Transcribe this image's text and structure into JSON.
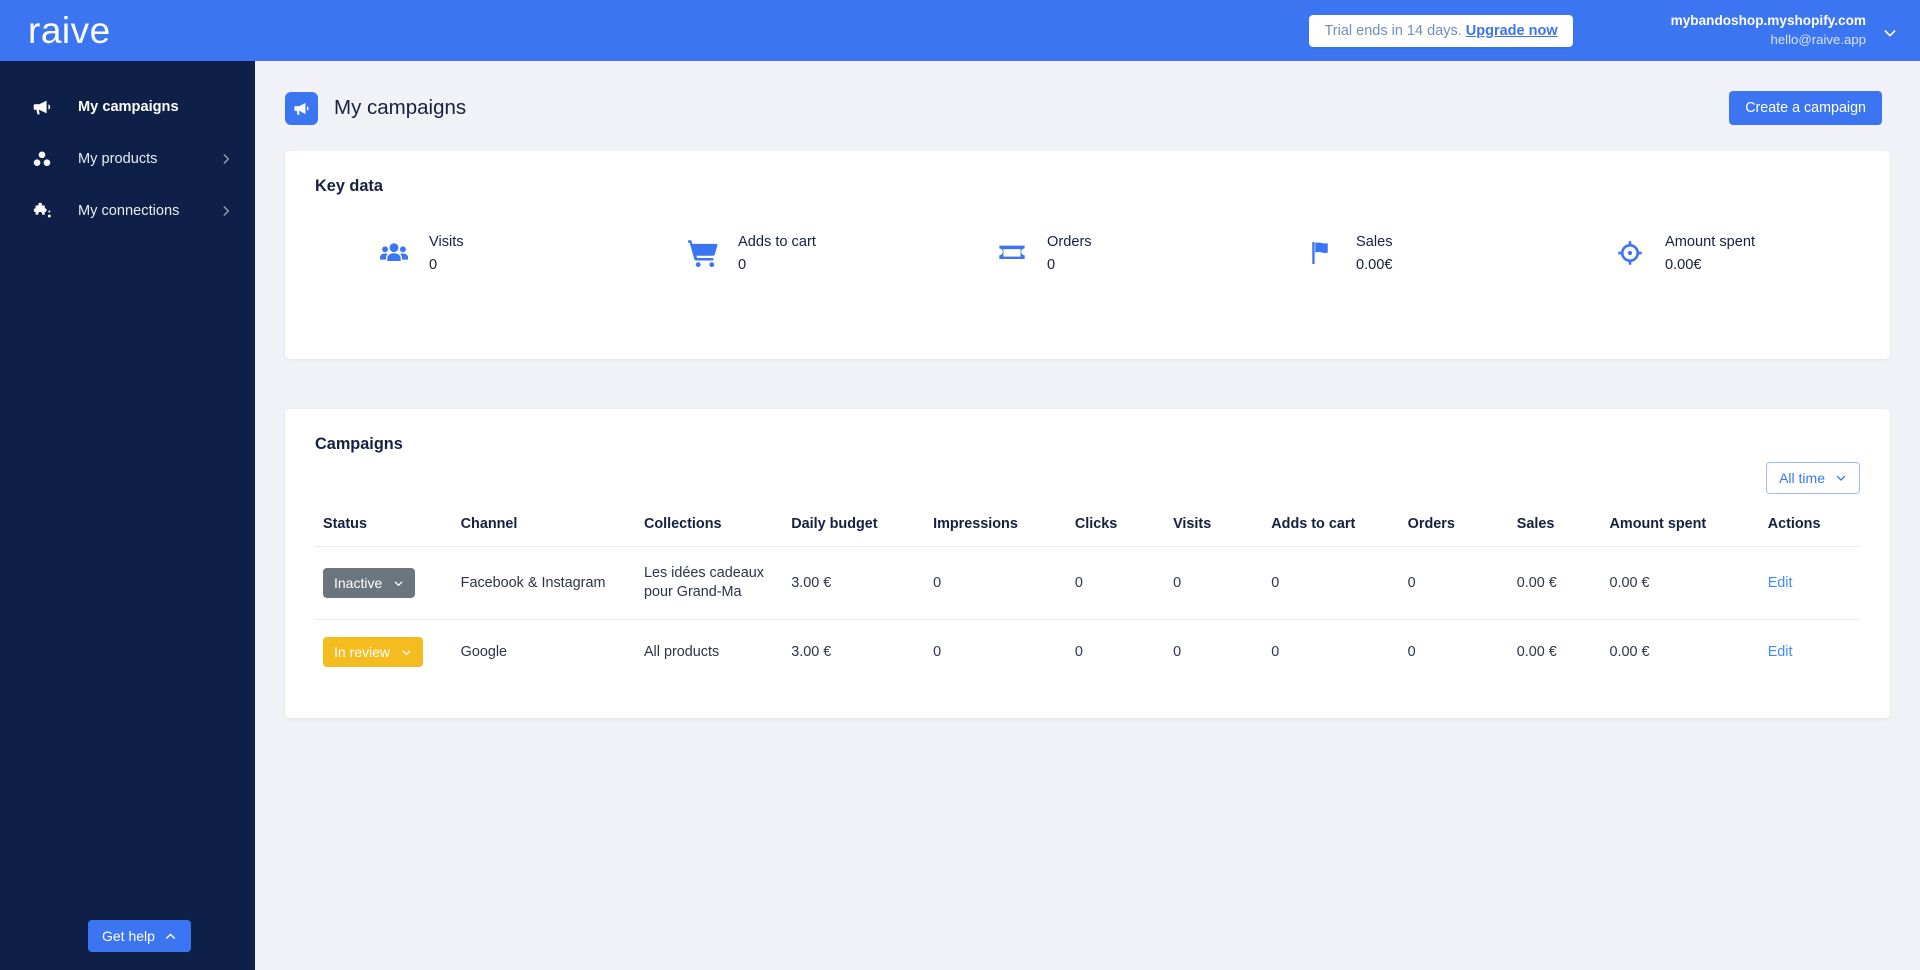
{
  "brand": {
    "name": "raive",
    "accent": "#3b75f2",
    "sidebar_bg": "#0e2047"
  },
  "topbar": {
    "trial_text": "Trial ends in 14 days.",
    "upgrade_label": "Upgrade now",
    "shop": "mybandoshop.myshopify.com",
    "email": "hello@raive.app",
    "account_chevron": "chevron-down-icon"
  },
  "sidebar": {
    "items": [
      {
        "label": "My campaigns",
        "icon": "megaphone-icon",
        "active": true,
        "has_chevron": false
      },
      {
        "label": "My products",
        "icon": "products-cubes-icon",
        "active": false,
        "has_chevron": true
      },
      {
        "label": "My connections",
        "icon": "puzzle-piece-icon",
        "active": false,
        "has_chevron": true
      }
    ],
    "get_help_label": "Get help",
    "get_help_icon": "chevron-up-icon"
  },
  "page": {
    "title": "My campaigns",
    "icon": "megaphone-icon",
    "create_button": "Create a campaign"
  },
  "key_data": {
    "title": "Key data",
    "metrics": [
      {
        "label": "Visits",
        "value": "0",
        "icon": "people-group-icon"
      },
      {
        "label": "Adds to cart",
        "value": "0",
        "icon": "shopping-cart-icon"
      },
      {
        "label": "Orders",
        "value": "0",
        "icon": "ticket-icon"
      },
      {
        "label": "Sales",
        "value": "0.00€",
        "icon": "flag-icon"
      },
      {
        "label": "Amount spent",
        "value": "0.00€",
        "icon": "target-icon"
      }
    ]
  },
  "campaigns": {
    "title": "Campaigns",
    "range_label": "All time",
    "range_icon": "chevron-down-icon",
    "columns": [
      "Status",
      "Channel",
      "Collections",
      "Daily budget",
      "Impressions",
      "Clicks",
      "Visits",
      "Adds to cart",
      "Orders",
      "Sales",
      "Amount spent",
      "Actions"
    ],
    "rows": [
      {
        "status": "Inactive",
        "status_type": "inactive",
        "status_color": "#6b757e",
        "channel": "Facebook & Instagram",
        "collections": "Les idées cadeaux pour Grand-Ma",
        "daily_budget": "3.00 €",
        "impressions": "0",
        "clicks": "0",
        "visits": "0",
        "adds_to_cart": "0",
        "orders": "0",
        "sales": "0.00 €",
        "amount_spent": "0.00 €",
        "action": "Edit"
      },
      {
        "status": "In review",
        "status_type": "review",
        "status_color": "#f5bc20",
        "channel": "Google",
        "collections": "All products",
        "daily_budget": "3.00 €",
        "impressions": "0",
        "clicks": "0",
        "visits": "0",
        "adds_to_cart": "0",
        "orders": "0",
        "sales": "0.00 €",
        "amount_spent": "0.00 €",
        "action": "Edit"
      }
    ]
  }
}
